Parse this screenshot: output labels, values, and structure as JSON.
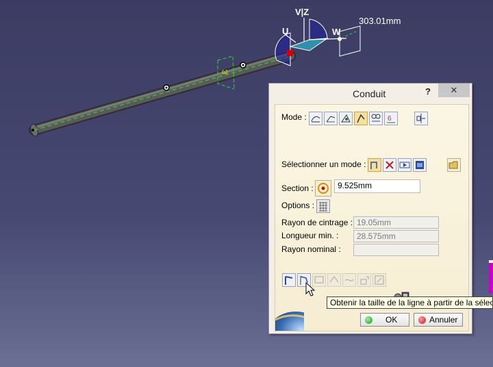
{
  "viewport": {
    "axis_labels": {
      "v_z": "V|Z",
      "u": "U",
      "w": "W"
    },
    "dimension": "303.01mm",
    "colors": {
      "background_top": "#3c3c63",
      "background_bottom": "#6b6f93",
      "tube": "#4e4e4e",
      "centerline": "#2fc42f",
      "manipulator": "#1e1e9c"
    }
  },
  "dialog": {
    "title": "Conduit",
    "help": "?",
    "close": "✕",
    "mode_label": "Mode :",
    "mode_buttons": [
      "mode-line-icon",
      "mode-spline-icon",
      "mode-point-icon",
      "mode-route-icon",
      "mode-offset-icon",
      "mode-slope-icon",
      "mode-break-icon"
    ],
    "select_mode_label": "Sélectionner un mode :",
    "select_mode_buttons": [
      "select-route-icon",
      "select-cancel-icon",
      "select-play-icon",
      "select-database-icon"
    ],
    "open_folder_icon": "folder-open-icon",
    "section_label": "Section :",
    "section_value": "9.525mm",
    "options_label": "Options :",
    "bend_radius_label": "Rayon de cintrage :",
    "bend_radius_value": "19.05mm",
    "min_length_label": "Longueur min. :",
    "min_length_value": "28.575mm",
    "nominal_radius_label": "Rayon nominal :",
    "nominal_radius_value": "",
    "bottom_tools": [
      "line-size-icon",
      "line-flag-icon",
      "tool-disabled-1-icon",
      "tool-disabled-2-icon",
      "tool-disabled-3-icon",
      "tool-disabled-4-icon",
      "tool-disabled-5-icon"
    ],
    "ok_label": "OK",
    "cancel_label": "Annuler"
  },
  "tooltip": "Obtenir la taille de la ligne à partir de la sélection"
}
